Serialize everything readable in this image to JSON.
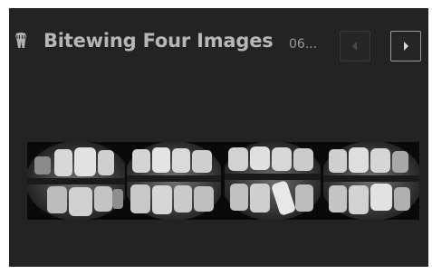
{
  "header": {
    "icon": "tooth-icon",
    "title": "Bitewing Four Images",
    "date_truncated": "06..."
  },
  "navigation": {
    "prev_icon": "chevron-left-icon",
    "next_icon": "chevron-right-icon",
    "prev_enabled": false,
    "next_enabled": true
  },
  "images": [
    {
      "label": "bitewing-1"
    },
    {
      "label": "bitewing-2"
    },
    {
      "label": "bitewing-3"
    },
    {
      "label": "bitewing-4"
    }
  ],
  "colors": {
    "panel_bg": "#232323",
    "title_text": "#b7b7b7",
    "film_bg": "#0a0a0a"
  }
}
